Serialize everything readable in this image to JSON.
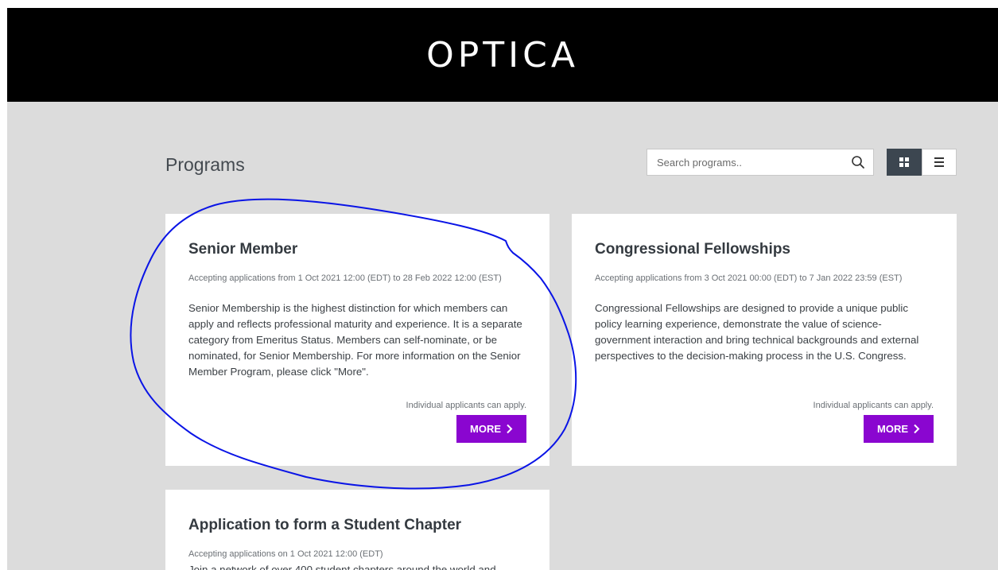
{
  "header": {
    "logo_text": "OPTICA"
  },
  "page": {
    "title": "Programs"
  },
  "search": {
    "placeholder": "Search programs.."
  },
  "view_toggle": {
    "grid_icon": "grid-icon",
    "list_icon": "list-icon",
    "active": "grid"
  },
  "programs": [
    {
      "title": "Senior Member",
      "dates": "Accepting applications from 1 Oct 2021 12:00 (EDT) to 28 Feb 2022 12:00 (EST)",
      "description": "Senior Membership is the highest distinction for which members can apply and reflects professional maturity and experience.  It is a separate category from Emeritus Status. Members can self-nominate, or be nominated, for Senior Membership. For more information on the Senior Member Program, please click \"More\".",
      "applicants": "Individual applicants can apply.",
      "more_label": "MORE"
    },
    {
      "title": "Congressional Fellowships",
      "dates": "Accepting applications from 3 Oct 2021 00:00 (EDT) to 7 Jan 2022 23:59 (EST)",
      "description": "Congressional Fellowships are designed to provide a unique public policy learning experience, demonstrate the value of science-government interaction and bring technical backgrounds and external perspectives to the decision-making process in the U.S. Congress.",
      "applicants": "Individual applicants can apply.",
      "more_label": "MORE"
    },
    {
      "title": "Application to form a Student Chapter",
      "dates": "Accepting applications on 1 Oct 2021 12:00 (EDT)",
      "description": "Join a network of over 400 student chapters around the world and",
      "applicants": "",
      "more_label": ""
    }
  ],
  "colors": {
    "header_bg": "#000000",
    "page_bg": "#dcdcdc",
    "accent": "#8a06d0",
    "toggle_active": "#3c4650",
    "annotation": "#0a14e6"
  }
}
